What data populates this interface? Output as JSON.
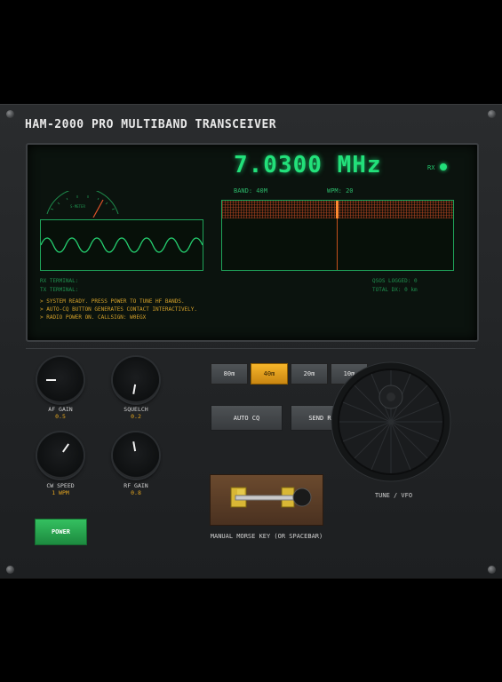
{
  "title": "HAM-2000 PRO MULTIBAND TRANSCEIVER",
  "display": {
    "frequency": "7.0300 MHz",
    "rx_label": "RX",
    "band": "BAND: 40M",
    "wpm": "WPM: 20",
    "meter_label": "S-METER",
    "rx_terminal": "RX TERMINAL:",
    "tx_terminal": "TX TERMINAL:",
    "qsos": "QSOS LOGGED: 0",
    "total": "TOTAL DX: 0 km",
    "log": [
      "> SYSTEM READY. PRESS POWER TO TUNE HF BANDS.",
      "> AUTO-CQ BUTTON GENERATES CONTACT INTERACTIVELY.",
      "> RADIO POWER ON. CALLSIGN: W0EGX"
    ],
    "colors": {
      "phosphor": "#22e07a",
      "log": "#d4a12a",
      "waterfall": "#c4501c"
    }
  },
  "knobs": [
    {
      "label": "AF GAIN",
      "value": "0.5",
      "rotation": -90
    },
    {
      "label": "SQUELCH",
      "value": "0.2",
      "rotation": 190
    },
    {
      "label": "CW SPEED",
      "value": "1 WPM",
      "rotation": 35
    },
    {
      "label": "RF GAIN",
      "value": "0.8",
      "rotation": -10
    }
  ],
  "power_label": "POWER",
  "bands": [
    {
      "label": "80m",
      "active": false
    },
    {
      "label": "40m",
      "active": true
    },
    {
      "label": "20m",
      "active": false
    },
    {
      "label": "10m",
      "active": false
    }
  ],
  "actions": {
    "auto_cq": "AUTO CQ",
    "send_report": "SEND REPORT"
  },
  "key_label": "MANUAL MORSE KEY (OR SPACEBAR)",
  "vfo_label": "TUNE / VFO"
}
